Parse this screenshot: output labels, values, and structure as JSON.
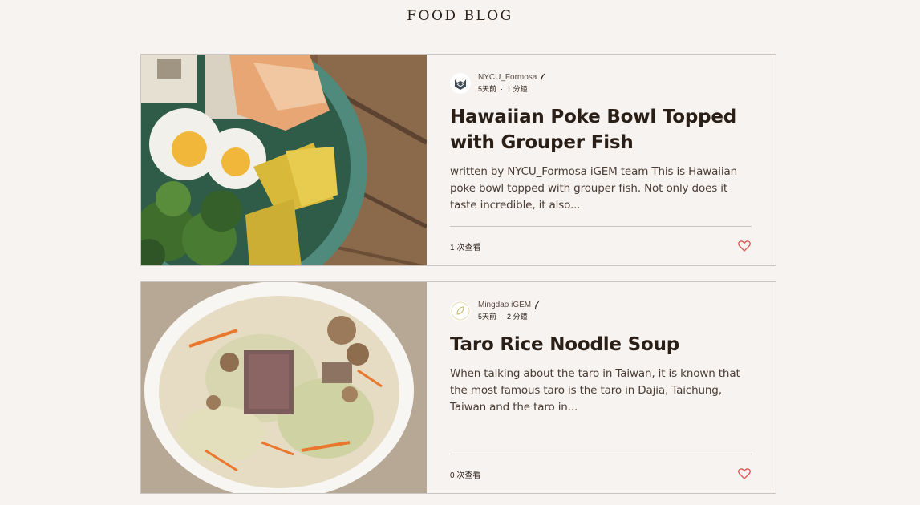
{
  "blog": {
    "title": "FOOD BLOG"
  },
  "posts": [
    {
      "author": "NYCU_Formosa",
      "age": "5天前",
      "separator": "·",
      "read_time": "1 分鐘",
      "title": "Hawaiian Poke Bowl Topped with Grouper Fish",
      "excerpt": "written by NYCU_Formosa iGEM team This is Hawaiian poke bowl topped with grouper fish. Not only does it taste incredible, it also...",
      "views": "1 次查看",
      "cover_icon": "poke-bowl-photo",
      "avatar_icon": "wolf-avatar-icon"
    },
    {
      "author": "Mingdao iGEM",
      "age": "5天前",
      "separator": "·",
      "read_time": "2 分鐘",
      "title": "Taro Rice Noodle Soup",
      "excerpt": "When talking about the taro in Taiwan, it is known that the most famous taro is the taro in Dajia, Taichung, Taiwan and the taro in...",
      "views": "0 次查看",
      "cover_icon": "noodle-soup-photo",
      "avatar_icon": "leaf-avatar-icon"
    }
  ],
  "colors": {
    "background": "#f7f3f0",
    "text": "#2a1f17",
    "border": "#c9c4c0",
    "like": "#d9534f"
  }
}
